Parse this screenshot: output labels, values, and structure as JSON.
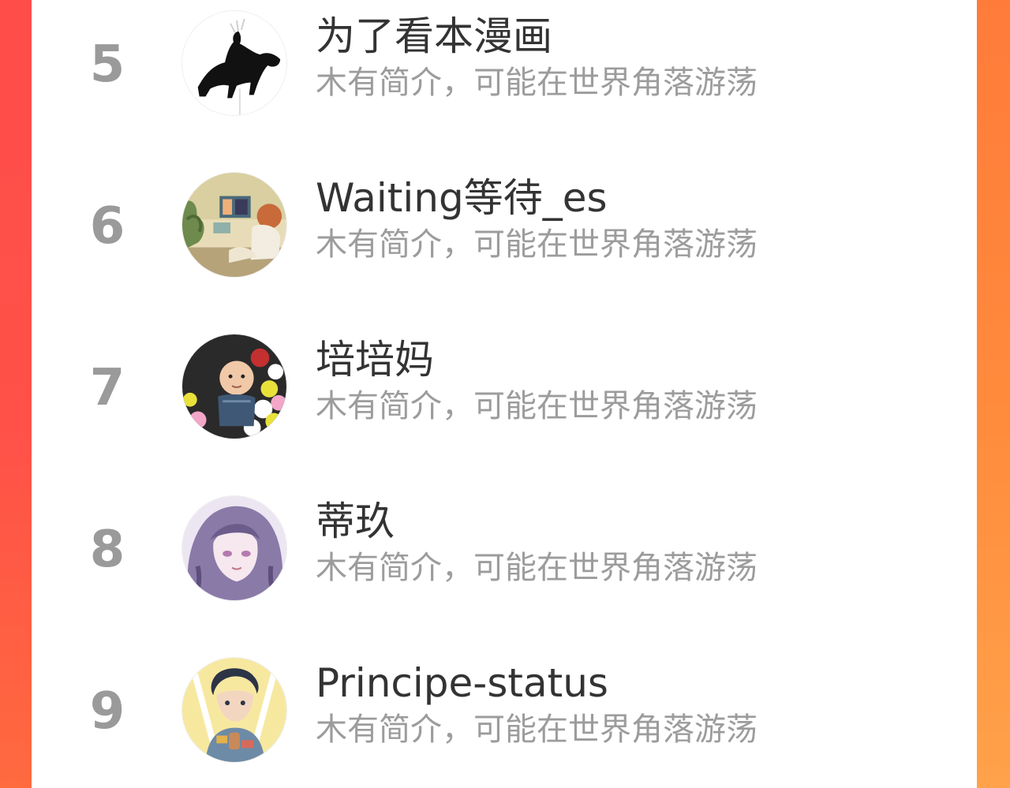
{
  "colors": {
    "accent_left": "#ff4d4a",
    "accent_right": "#ff8a3c",
    "panel": "#ffffff",
    "rank_text": "#9a9a9a",
    "name_text": "#333333",
    "bio_text": "#9c9c9c"
  },
  "list": {
    "items": [
      {
        "rank": "5",
        "name": "为了看本漫画",
        "bio": "木有简介，可能在世界角落游荡",
        "avatar_icon": "black-cat-avatar"
      },
      {
        "rank": "6",
        "name": "Waiting等待_es",
        "bio": "木有简介，可能在世界角落游荡",
        "avatar_icon": "room-girl-avatar"
      },
      {
        "rank": "7",
        "name": "培培妈",
        "bio": "木有简介，可能在世界角落游荡",
        "avatar_icon": "baby-ball-pit-avatar"
      },
      {
        "rank": "8",
        "name": "蒂玖",
        "bio": "木有简介，可能在世界角落游荡",
        "avatar_icon": "anime-girl-avatar"
      },
      {
        "rank": "9",
        "name": "Principe-status",
        "bio": "木有简介，可能在世界角落游荡",
        "avatar_icon": "anime-boy-avatar"
      }
    ]
  }
}
